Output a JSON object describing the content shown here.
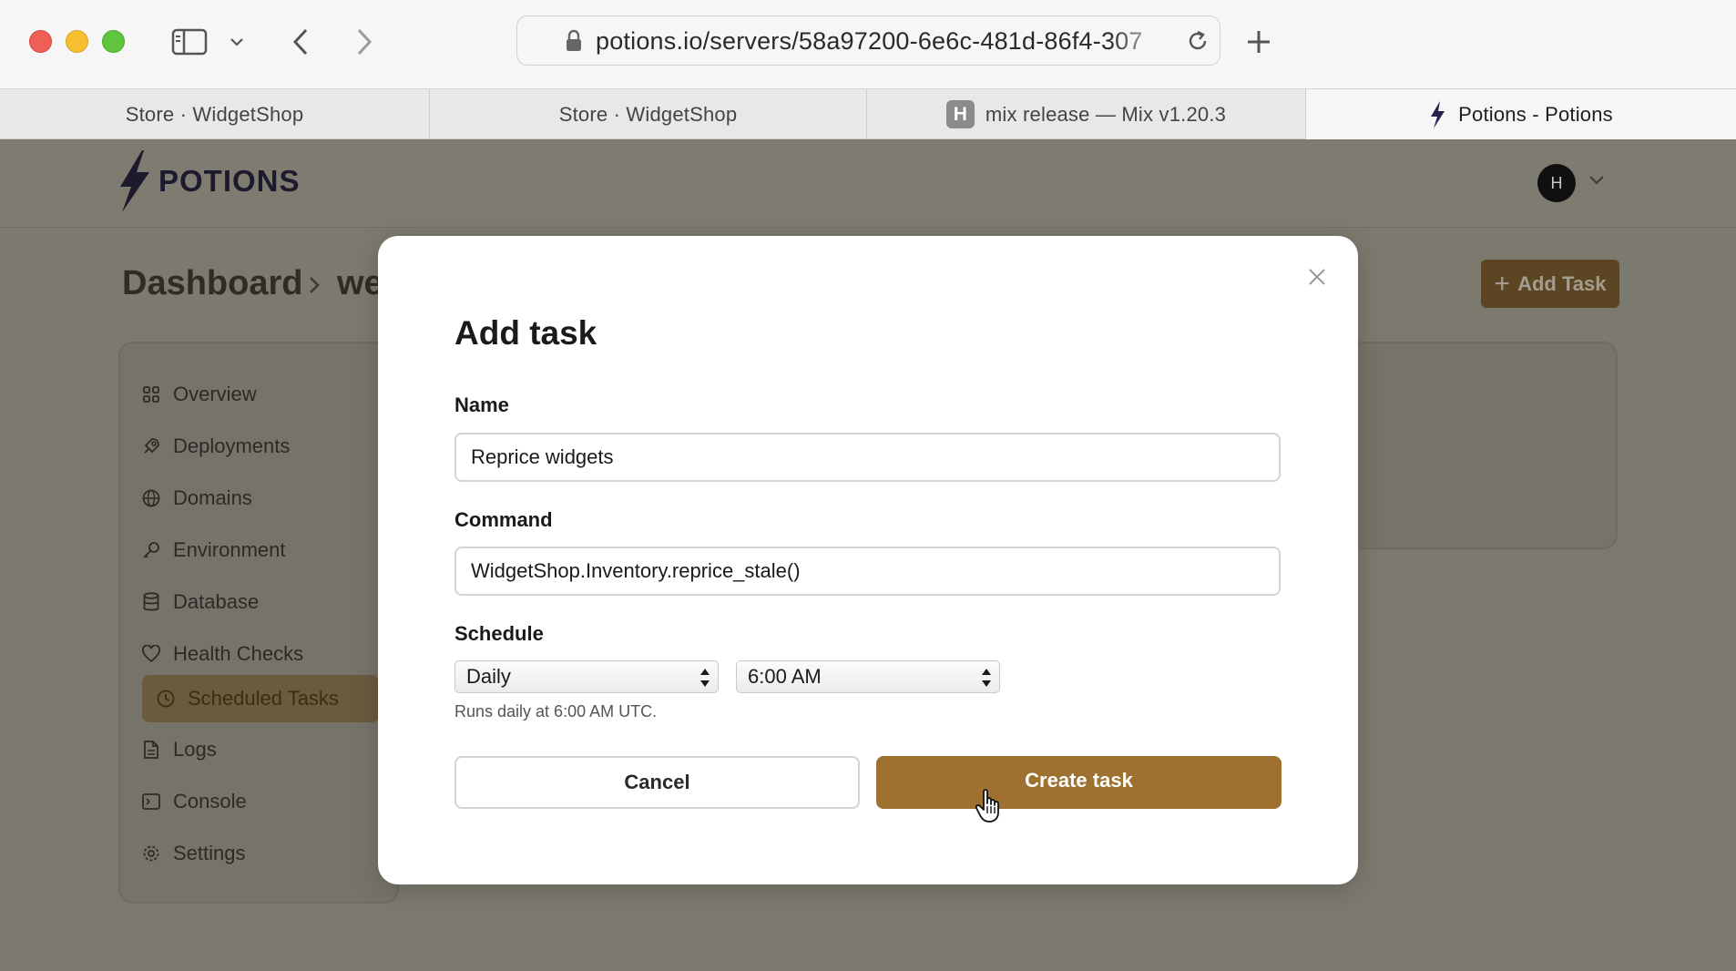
{
  "browser": {
    "url": "potions.io/servers/58a97200-6e6c-481d-86f4-307",
    "tabs": [
      {
        "label": "Store · WidgetShop"
      },
      {
        "label": "Store · WidgetShop"
      },
      {
        "label": "mix release — Mix v1.20.3",
        "badge": "H"
      },
      {
        "label": "Potions - Potions"
      }
    ]
  },
  "header": {
    "logo_text": "POTIONS",
    "avatar_initial": "H"
  },
  "page": {
    "breadcrumb_root": "Dashboard",
    "breadcrumb_current": "we",
    "add_task_label": "Add Task"
  },
  "sidebar": {
    "items": [
      {
        "label": "Overview",
        "icon": "grid-icon"
      },
      {
        "label": "Deployments",
        "icon": "rocket-icon"
      },
      {
        "label": "Domains",
        "icon": "globe-icon"
      },
      {
        "label": "Environment",
        "icon": "key-icon"
      },
      {
        "label": "Database",
        "icon": "database-icon"
      },
      {
        "label": "Health Checks",
        "icon": "heart-icon"
      },
      {
        "label": "Scheduled Tasks",
        "icon": "clock-icon",
        "active": true
      },
      {
        "label": "Logs",
        "icon": "file-icon"
      },
      {
        "label": "Console",
        "icon": "terminal-icon"
      },
      {
        "label": "Settings",
        "icon": "gear-icon"
      }
    ]
  },
  "modal": {
    "title": "Add task",
    "name_label": "Name",
    "name_value": "Reprice widgets",
    "command_label": "Command",
    "command_value": "WidgetShop.Inventory.reprice_stale()",
    "schedule_label": "Schedule",
    "frequency_value": "Daily",
    "time_value": "6:00 AM",
    "hint": "Runs daily at 6:00 AM UTC.",
    "cancel_label": "Cancel",
    "create_label": "Create task"
  },
  "colors": {
    "accent": "#9e7130",
    "overlay": "#7c7a6e"
  }
}
